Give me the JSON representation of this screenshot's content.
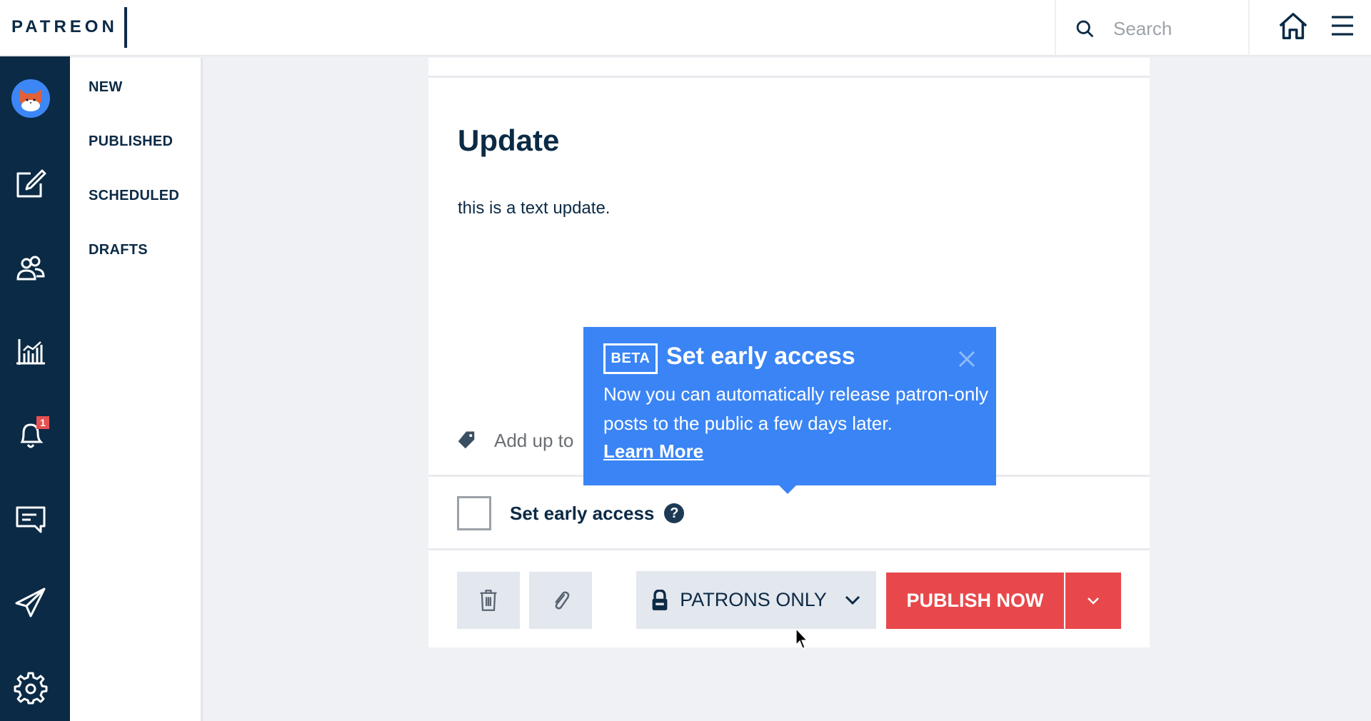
{
  "header": {
    "logo": "PATREON",
    "search_placeholder": "Search",
    "icons": {
      "search": "search-icon",
      "home": "home-icon",
      "menu": "hamburger-menu-icon"
    }
  },
  "leftnav": {
    "items": [
      {
        "name": "avatar",
        "icon": "fox-avatar"
      },
      {
        "name": "create-post",
        "icon": "edit-icon"
      },
      {
        "name": "patrons",
        "icon": "users-icon"
      },
      {
        "name": "analytics",
        "icon": "chart-icon"
      },
      {
        "name": "notifications",
        "icon": "bell-icon",
        "badge": "1"
      },
      {
        "name": "messages",
        "icon": "message-icon"
      },
      {
        "name": "send",
        "icon": "paper-plane-icon"
      },
      {
        "name": "settings",
        "icon": "gear-icon"
      }
    ]
  },
  "subnav": {
    "items": [
      {
        "label": "NEW"
      },
      {
        "label": "PUBLISHED"
      },
      {
        "label": "SCHEDULED"
      },
      {
        "label": "DRAFTS"
      }
    ]
  },
  "post": {
    "title": "Update",
    "body": "this is a text update.",
    "tags_placeholder": "Add up to",
    "early_access_label": "Set early access",
    "early_access_checked": false,
    "help_glyph": "?"
  },
  "toolbar": {
    "privacy_label": "PATRONS ONLY",
    "publish_label": "PUBLISH NOW"
  },
  "tooltip": {
    "badge": "BETA",
    "title": "Set early access",
    "body": "Now you can automatically release patron-only posts to the public a few days later.",
    "link": "Learn More"
  },
  "colors": {
    "navy": "#0b2a45",
    "tooltip_blue": "#3a84f5",
    "publish_red": "#e8484b",
    "button_gray": "#e3e7ee",
    "page_bg": "#f0f1f5"
  }
}
